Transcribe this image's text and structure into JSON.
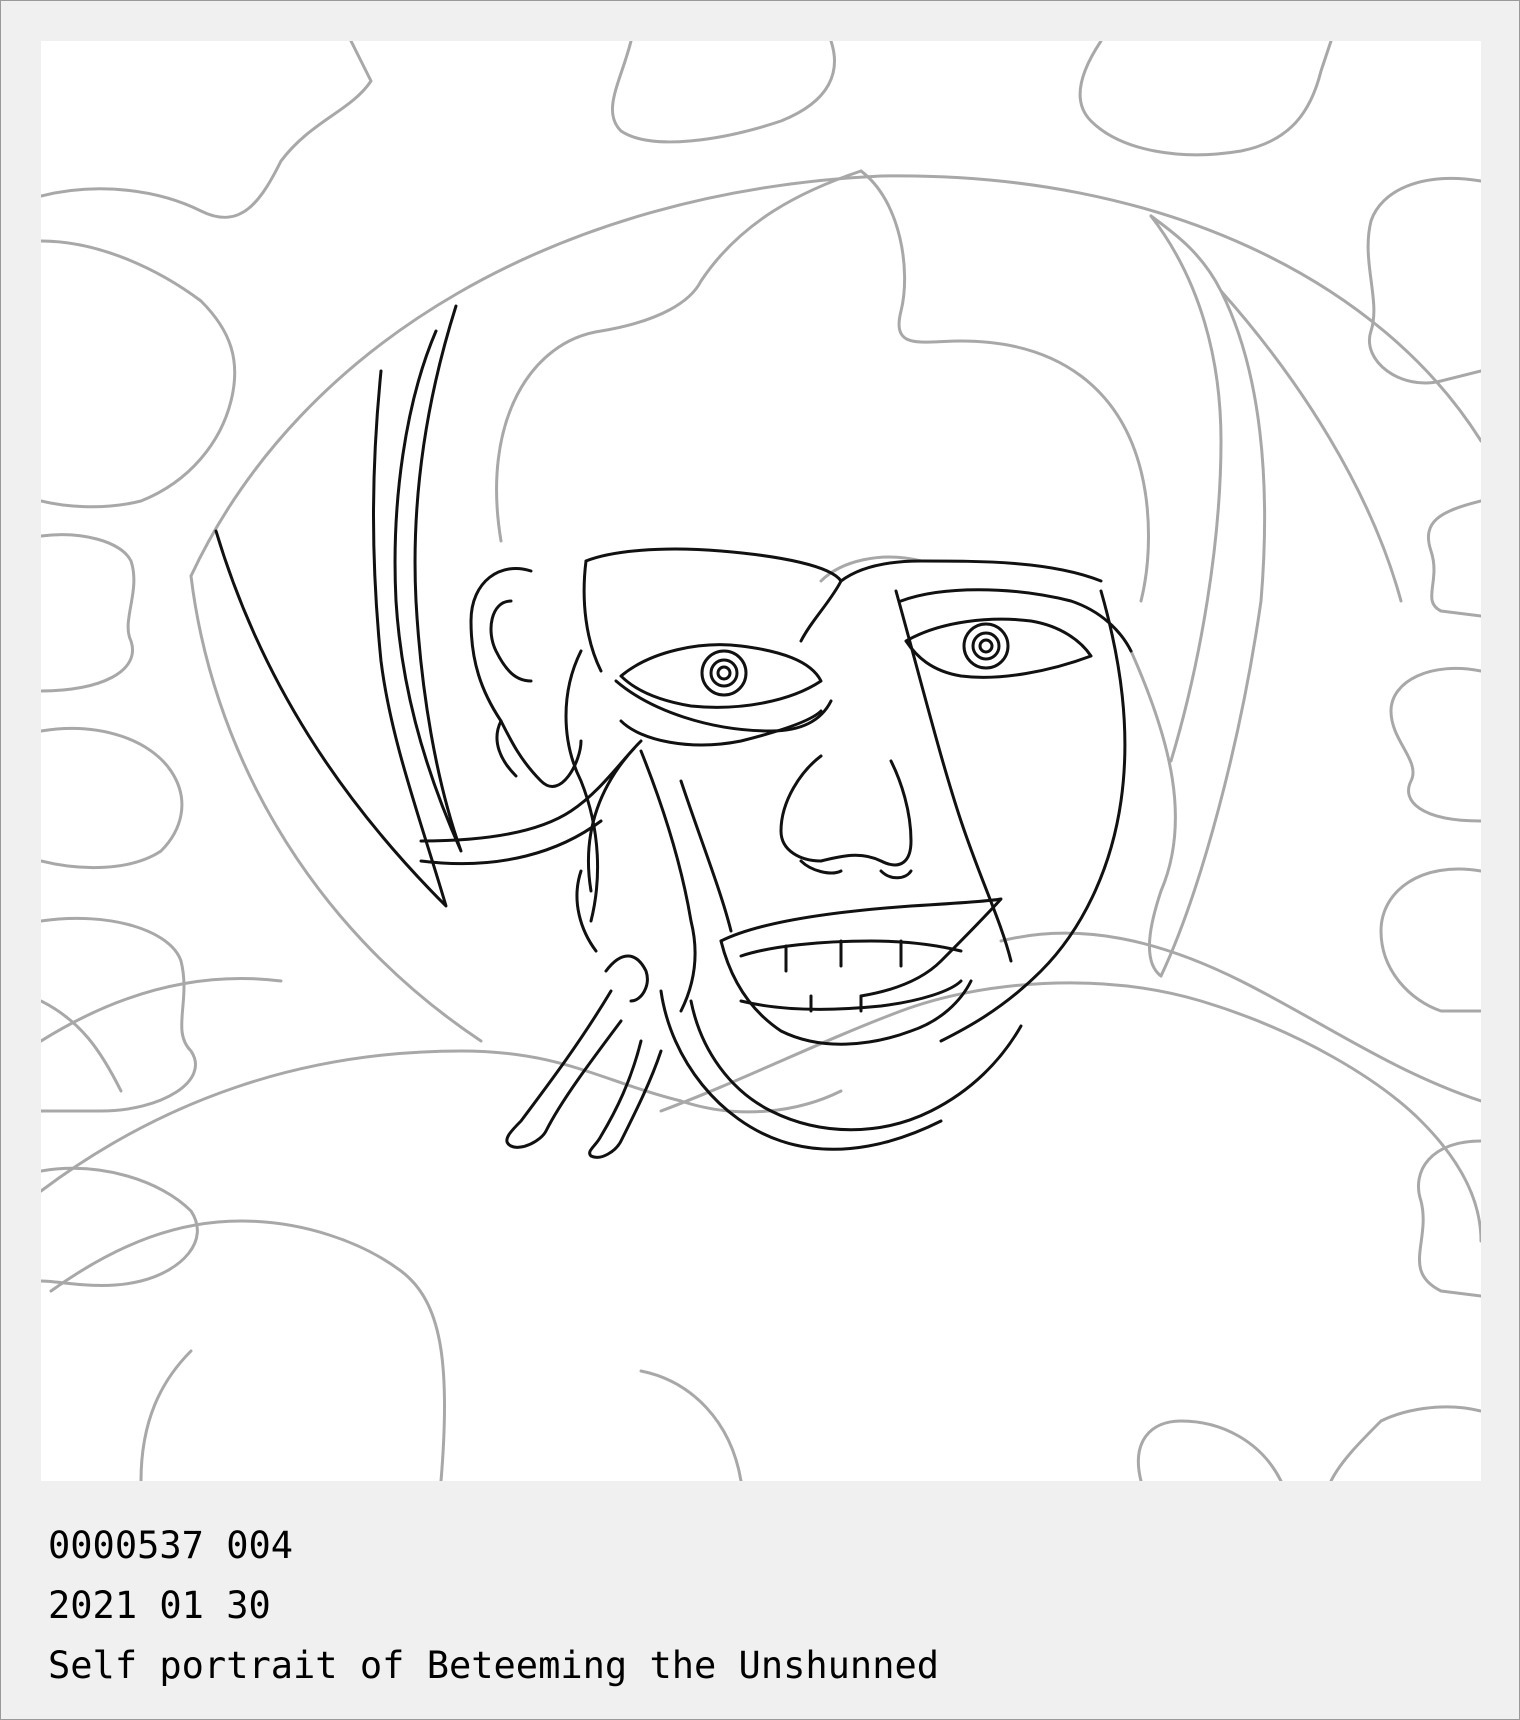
{
  "caption": {
    "id_line": "0000537 004",
    "date_line": "2021 01 30",
    "title_line": "Self portrait of Beteeming the Unshunned"
  },
  "colors": {
    "page_background": "#f0f0f0",
    "artwork_background": "#ffffff",
    "light_lines": "#a8a8a8",
    "dark_lines": "#111111",
    "text": "#000000"
  }
}
